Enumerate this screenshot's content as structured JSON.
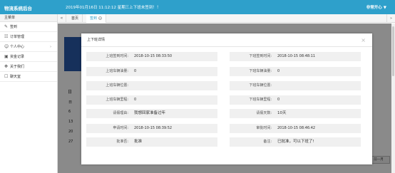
{
  "app": {
    "title": "物流系统后台",
    "marquee": "2019年01月16日 11:12:12 星期三上下班未签到！！",
    "user": "非常开心",
    "user_caret": "▼"
  },
  "sidebar": {
    "header": "主菜单",
    "items": [
      {
        "icon": "✎",
        "icon_name": "edit-icon",
        "label": "签到",
        "arrow": ""
      },
      {
        "icon": "☷",
        "icon_name": "order-icon",
        "label": "订单管理",
        "arrow": ""
      },
      {
        "icon": "☺",
        "icon_name": "user-icon",
        "label": "个人中心",
        "arrow": "›"
      },
      {
        "icon": "▣",
        "icon_name": "record-icon",
        "label": "资金记录",
        "arrow": ""
      },
      {
        "icon": "✥",
        "icon_name": "about-icon",
        "label": "关于我们",
        "arrow": ""
      },
      {
        "icon": "☐",
        "icon_name": "chat-icon",
        "label": "聊天室",
        "arrow": ""
      }
    ]
  },
  "tabs": {
    "left_arrow": "«",
    "right_arrow": "»",
    "items": [
      {
        "label": "首页",
        "active": false
      },
      {
        "label": "签到",
        "active": true,
        "close": "×"
      }
    ]
  },
  "background": {
    "cal_title": "日",
    "cal_days": [
      "日",
      "6",
      "13",
      "20",
      "27"
    ],
    "button": "前一月"
  },
  "modal": {
    "title": "上下班详情",
    "close": "×",
    "fields": [
      {
        "label": "上班签到时间:",
        "value": "2018-10-15 08:33:50"
      },
      {
        "label": "下班签到时间:",
        "value": "2018-10-15 08:48:11"
      },
      {
        "label": "上班车辆油量:",
        "value": "0"
      },
      {
        "label": "下班车辆油量:",
        "value": "0"
      },
      {
        "label": "上班车辆位置:",
        "value": ""
      },
      {
        "label": "下班车辆位置:",
        "value": ""
      },
      {
        "label": "上班车辆里程:",
        "value": "0"
      },
      {
        "label": "下班车辆里程:",
        "value": "0"
      },
      {
        "label": "请假理由:",
        "value": "我想回家准备过年"
      },
      {
        "label": "请假天数:",
        "value": "10天"
      },
      {
        "label": "申请时间:",
        "value": "2018-10-15 08:39:52"
      },
      {
        "label": "审批时间:",
        "value": "2018-10-15 08:46:42"
      },
      {
        "label": "批准否:",
        "value": "批准"
      },
      {
        "label": "备注:",
        "value": "已批准，可以下班了!"
      }
    ]
  },
  "colors": {
    "accent": "#2ea0cb",
    "overlay": "rgba(0,0,0,0.46)",
    "field_bg": "#f0f0f0"
  }
}
